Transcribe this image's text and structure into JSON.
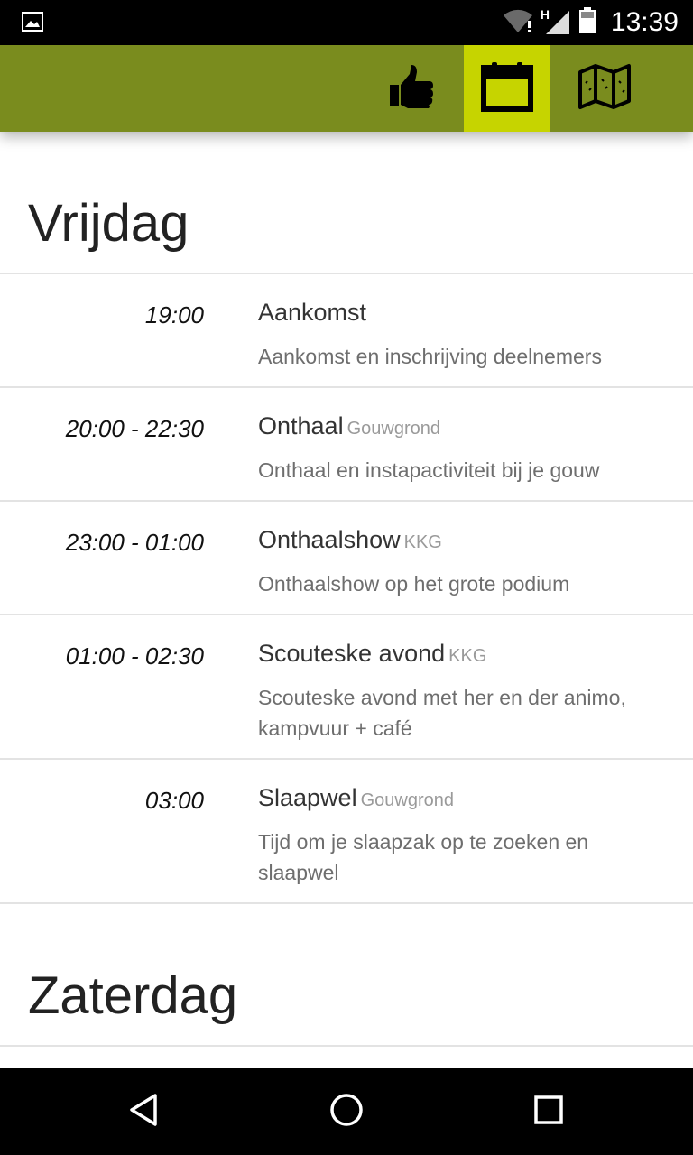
{
  "status_bar": {
    "time": "13:39",
    "network_label": "H",
    "icons": [
      "image-icon",
      "wifi-icon",
      "signal-icon",
      "battery-icon"
    ]
  },
  "app_bar": {
    "tabs": [
      {
        "icon": "thumbs-up-icon",
        "active": false
      },
      {
        "icon": "calendar-icon",
        "active": true
      },
      {
        "icon": "map-icon",
        "active": false
      }
    ],
    "colors": {
      "bar": "#7a8c1e",
      "active_tab": "#c6d400"
    }
  },
  "days": [
    {
      "name": "Vrijdag",
      "events": [
        {
          "time": "19:00",
          "title": "Aankomst",
          "location": "",
          "description": "Aankomst en inschrijving deelnemers"
        },
        {
          "time": "20:00 - 22:30",
          "title": "Onthaal",
          "location": "Gouwgrond",
          "description": "Onthaal en instapactiviteit bij je gouw"
        },
        {
          "time": "23:00 - 01:00",
          "title": "Onthaalshow",
          "location": "KKG",
          "description": "Onthaalshow op het grote podium"
        },
        {
          "time": "01:00 - 02:30",
          "title": "Scouteske avond",
          "location": "KKG",
          "description": "Scouteske avond met her en der animo, kampvuur + café"
        },
        {
          "time": "03:00",
          "title": "Slaapwel",
          "location": "Gouwgrond",
          "description": "Tijd om je slaapzak op te zoeken en slaapwel"
        }
      ]
    },
    {
      "name": "Zaterdag",
      "events": []
    }
  ],
  "nav_bar": {
    "buttons": [
      "back-icon",
      "home-icon",
      "recents-icon"
    ]
  }
}
